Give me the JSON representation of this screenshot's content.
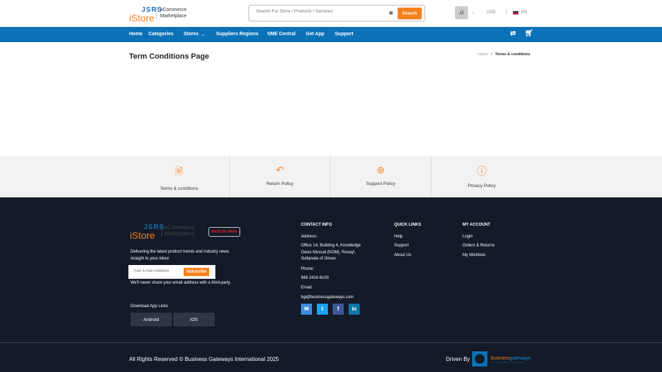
{
  "header": {
    "logo_top": "JSRS",
    "logo_bottom": "iStore",
    "tagline1": "eCommerce",
    "tagline2": "Marketplace",
    "search_placeholder": "Search For Store / Products / Services",
    "search_button": "Search",
    "currency": "USD",
    "language": "EN"
  },
  "nav": {
    "items": [
      "Home",
      "Categories",
      "Stores",
      "Suppliers Regions",
      "SME Central",
      "Get App",
      "Support"
    ]
  },
  "page": {
    "title": "Term Conditions Page",
    "breadcrumb_home": "Home",
    "breadcrumb_sep": "/",
    "breadcrumb_current": "Terms & conditions"
  },
  "policies": [
    {
      "label": "Terms & conditions",
      "icon": "document-icon"
    },
    {
      "label": "Return Policy",
      "icon": "return-icon"
    },
    {
      "label": "Support Policy",
      "icon": "lifebuoy-icon"
    },
    {
      "label": "Privacy Policy",
      "icon": "alert-circle-icon"
    }
  ],
  "footer": {
    "made_in": "MADE IN OMAN",
    "newsletter_text": "Delivering the latest product trends and industry news straight to your inbox",
    "email_placeholder": "Your Email Address",
    "subscribe": "Subscribe",
    "privacy_note": "We'll never share your email address with a third-party.",
    "download_title": "Download App Links",
    "android": "Android",
    "ios": "IOS",
    "contact": {
      "title": "CONTACT INFO",
      "address_label": "Address:",
      "address": "Office 14, Building 4, Knowledge Oasis Muscat (KOM), Rusayl, Sultanate of Oman.",
      "phone_label": "Phone:",
      "phone": "968 2416 6100",
      "email_label": "Email:",
      "email": "bgi@businessgateways.com"
    },
    "quick_links": {
      "title": "QUICK LINKS",
      "items": [
        "Help",
        "Support",
        "About Us"
      ]
    },
    "account": {
      "title": "MY ACCOUNT",
      "items": [
        "Login",
        "Orders & Returns",
        "My Wishlists"
      ]
    },
    "copyright": "All Rights Reserved © Business Gateways International 2025",
    "driven_by": "Driven By",
    "brand1": "business",
    "brand2": "gateways",
    "brand_sub": "INTERNATIONAL"
  },
  "colors": {
    "nav": "#0c72b8",
    "accent": "#f5821f",
    "footer": "#131a28"
  }
}
